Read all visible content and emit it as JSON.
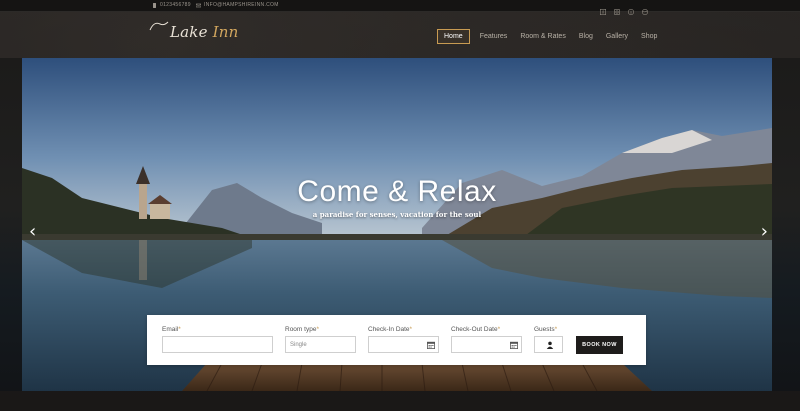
{
  "topbar": {
    "phone": "0123456789",
    "email": "INFO@HAMPSHIREINN.COM",
    "social_icons": [
      "facebook-icon",
      "instagram-icon",
      "pinterest-icon",
      "dribbble-icon"
    ]
  },
  "header": {
    "logo_part1": "Lake",
    "logo_part2": "Inn",
    "nav": [
      {
        "label": "Home",
        "active": true
      },
      {
        "label": "Features",
        "active": false
      },
      {
        "label": "Room & Rates",
        "active": false
      },
      {
        "label": "Gallery",
        "active": false
      },
      {
        "label": "Blog",
        "active": false
      },
      {
        "label": "Shop",
        "active": false
      }
    ]
  },
  "hero": {
    "title": "Come & Relax",
    "subtitle": "a paradise for senses, vacation for the soul",
    "prev_glyph": "‹",
    "next_glyph": "›"
  },
  "booking": {
    "email_label": "Email",
    "email_value": "",
    "room_type_label": "Room type",
    "room_type_value": "Single",
    "check_in_label": "Check-In Date",
    "check_in_value": "",
    "check_out_label": "Check-Out Date",
    "check_out_value": "",
    "guests_label": "Guests",
    "book_label": "BOOK NOW",
    "required_mark": "*"
  },
  "colors": {
    "accent": "#c89b52",
    "dark": "#1e1c1b"
  }
}
